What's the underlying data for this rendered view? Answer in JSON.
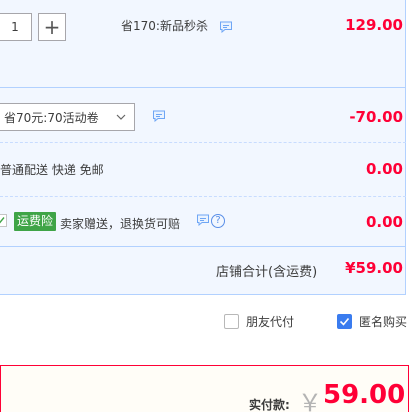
{
  "item": {
    "quantity": "1",
    "plus_symbol": "+",
    "promo_text": "省170:新品秒杀",
    "price": "129.00"
  },
  "coupon": {
    "selected": "省70元:70活动卷",
    "discount": "-70.00"
  },
  "shipping": {
    "text": "普通配送 快递 免邮",
    "price": "0.00"
  },
  "insurance": {
    "badge": "运费险",
    "text": "卖家赠送，退换货可赔",
    "help_symbol": "?",
    "price": "0.00"
  },
  "store_total": {
    "label": "店铺合计(含运费)",
    "value": "¥59.00"
  },
  "options": {
    "friend_pay": {
      "label": "朋友代付",
      "checked": false
    },
    "anonymous": {
      "label": "匿名购买",
      "checked": true
    }
  },
  "payment": {
    "label": "实付款:",
    "currency": "￥",
    "amount": "59.00"
  },
  "colors": {
    "accent_red": "#ff0036",
    "panel_bg": "#f2f7ff",
    "panel_border": "#b2d1ff",
    "insurance_green": "#3fa447",
    "checkbox_blue": "#3a7cef"
  },
  "icons": [
    "plus-icon",
    "chat-icon",
    "chevron-down-icon",
    "question-icon",
    "checkmark-icon"
  ]
}
